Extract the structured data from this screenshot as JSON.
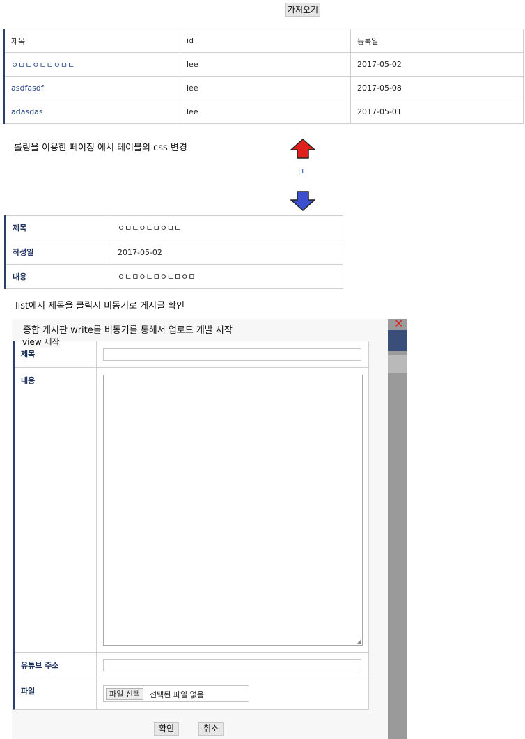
{
  "fetch_button": "가져오기",
  "list": {
    "headers": [
      "제목",
      "id",
      "등록일"
    ],
    "rows": [
      {
        "title": "ㅇㅁㄴㅇㄴㅁㅇㅁㄴ",
        "id": "lee",
        "date": "2017-05-02"
      },
      {
        "title": "asdfasdf",
        "id": "lee",
        "date": "2017-05-08"
      },
      {
        "title": "adasdas",
        "id": "lee",
        "date": "2017-05-01"
      }
    ]
  },
  "note_paging": "롤링을 이용한 페이징 에서 테이블의 css 변경",
  "pager": "|1|",
  "detail": {
    "title_label": "제목",
    "title_value": "ㅇㅁㄴㅇㄴㅁㅇㅁㄴ",
    "date_label": "작성일",
    "date_value": "2017-05-02",
    "content_label": "내용",
    "content_value": "ㅇㄴㅁㅇㄴㅁㅇㄴㅁㅇㅁ"
  },
  "note_list": "list에서 제목을 클릭시 비동기로 게시글 확인",
  "note_write": "종합 게시판 write를 비동기를 통해서 업로드 개발 시작",
  "write_form": {
    "legend": "view 제작",
    "title_label": "제목",
    "content_label": "내용",
    "youtube_label": "유튜브 주소",
    "file_label": "파일",
    "file_button": "파일 선택",
    "file_status": "선택된 파일 없음",
    "confirm_button": "확인",
    "cancel_button": "취소"
  },
  "colors": {
    "accent_border": "#2b3f6b",
    "link": "#2b4a8a",
    "arrow_up": "#e0201c",
    "arrow_down": "#3b4fcf",
    "close": "#e02020"
  },
  "icons": [
    "arrow-up-icon",
    "arrow-down-icon",
    "close-icon"
  ]
}
